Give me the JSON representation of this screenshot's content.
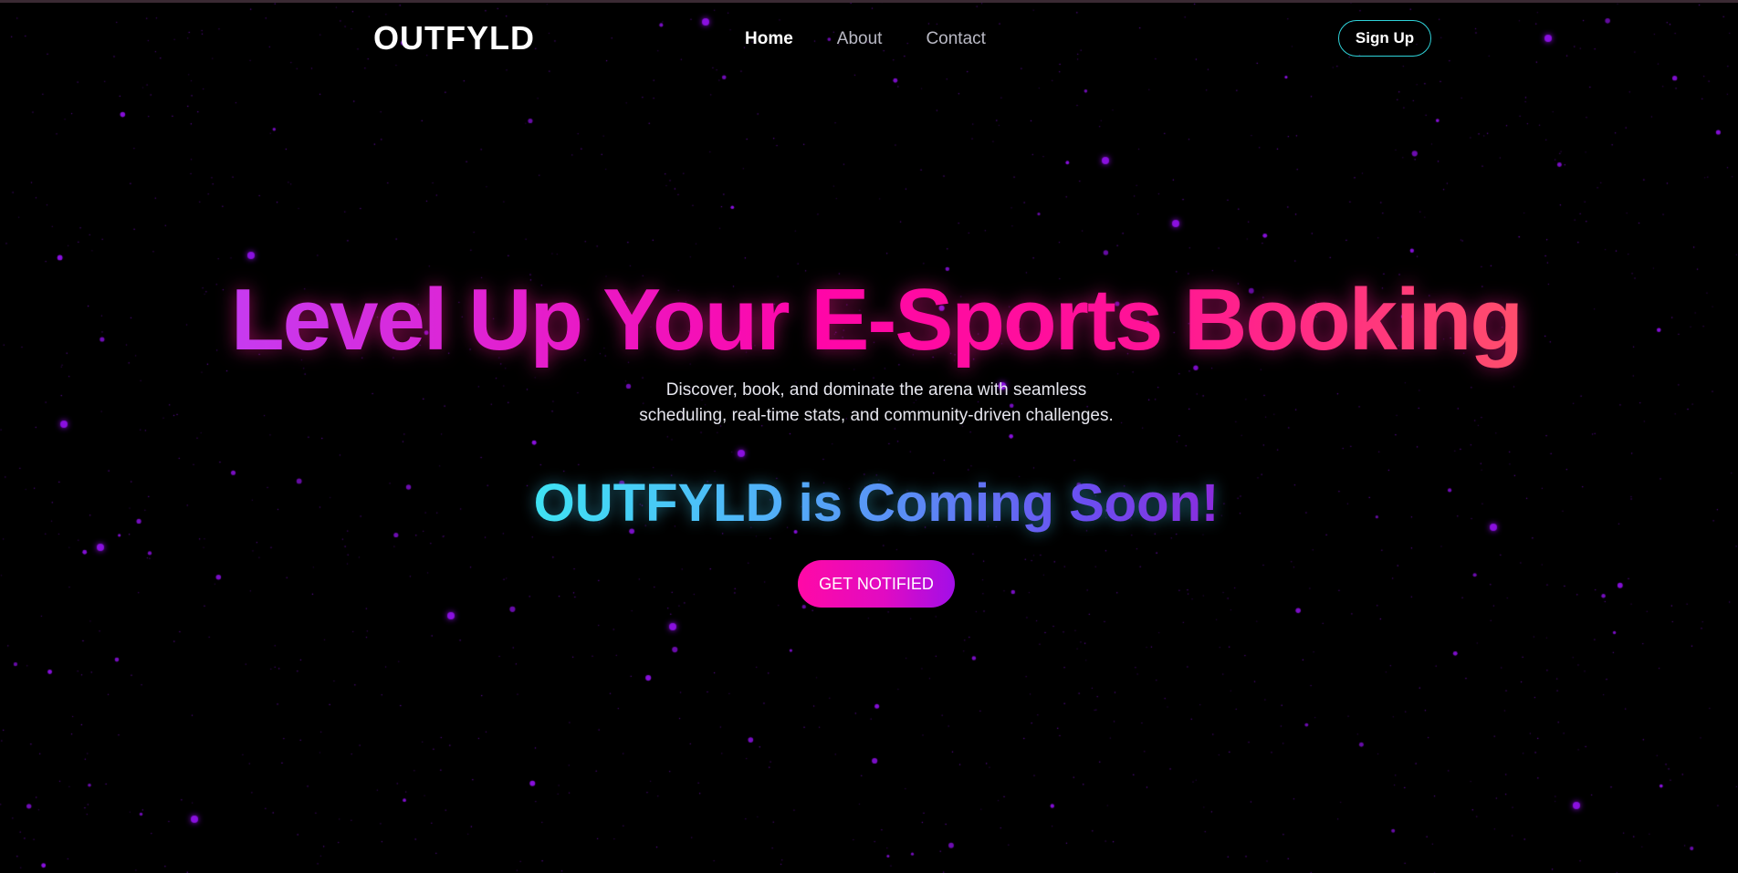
{
  "nav": {
    "logo": "OUTFYLD",
    "links": [
      {
        "label": "Home",
        "active": true
      },
      {
        "label": "About",
        "active": false
      },
      {
        "label": "Contact",
        "active": false
      }
    ],
    "signup_label": "Sign Up"
  },
  "hero": {
    "title": "Level Up Your E-Sports Booking",
    "subtitle": "Discover, book, and dominate the arena with seamless scheduling, real-time stats, and community-driven challenges.",
    "coming_soon": "OUTFYLD is Coming Soon!",
    "cta_label": "GET NOTIFIED"
  },
  "colors": {
    "background": "#000000",
    "star": "#8a10e0",
    "signup_border": "#2fd3d9",
    "title_gradient": [
      "#c63bf0",
      "#ff06a8",
      "#ff4e6c"
    ],
    "coming_gradient": [
      "#3fe3f4",
      "#5b8cf5",
      "#8b2bdc"
    ],
    "cta_gradient": [
      "#ff09a6",
      "#a20ee8"
    ]
  }
}
